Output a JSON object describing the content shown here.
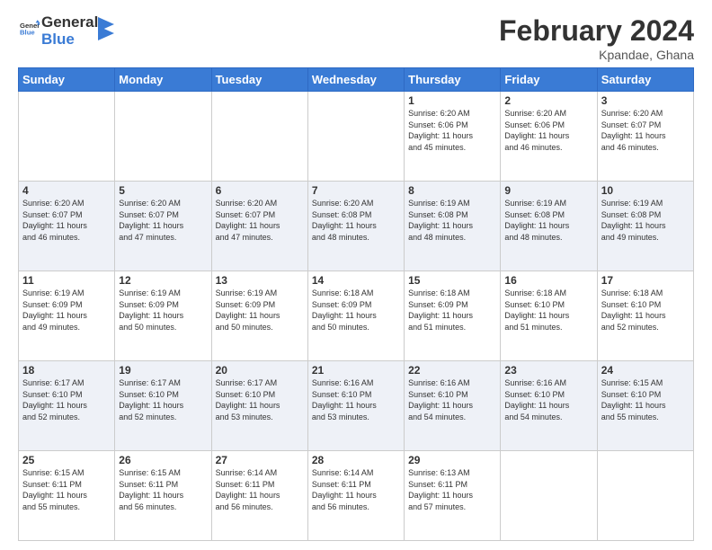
{
  "logo": {
    "line1": "General",
    "line2": "Blue"
  },
  "title": "February 2024",
  "location": "Kpandae, Ghana",
  "days_of_week": [
    "Sunday",
    "Monday",
    "Tuesday",
    "Wednesday",
    "Thursday",
    "Friday",
    "Saturday"
  ],
  "weeks": [
    [
      {
        "day": "",
        "info": ""
      },
      {
        "day": "",
        "info": ""
      },
      {
        "day": "",
        "info": ""
      },
      {
        "day": "",
        "info": ""
      },
      {
        "day": "1",
        "info": "Sunrise: 6:20 AM\nSunset: 6:06 PM\nDaylight: 11 hours\nand 45 minutes."
      },
      {
        "day": "2",
        "info": "Sunrise: 6:20 AM\nSunset: 6:06 PM\nDaylight: 11 hours\nand 46 minutes."
      },
      {
        "day": "3",
        "info": "Sunrise: 6:20 AM\nSunset: 6:07 PM\nDaylight: 11 hours\nand 46 minutes."
      }
    ],
    [
      {
        "day": "4",
        "info": "Sunrise: 6:20 AM\nSunset: 6:07 PM\nDaylight: 11 hours\nand 46 minutes."
      },
      {
        "day": "5",
        "info": "Sunrise: 6:20 AM\nSunset: 6:07 PM\nDaylight: 11 hours\nand 47 minutes."
      },
      {
        "day": "6",
        "info": "Sunrise: 6:20 AM\nSunset: 6:07 PM\nDaylight: 11 hours\nand 47 minutes."
      },
      {
        "day": "7",
        "info": "Sunrise: 6:20 AM\nSunset: 6:08 PM\nDaylight: 11 hours\nand 48 minutes."
      },
      {
        "day": "8",
        "info": "Sunrise: 6:19 AM\nSunset: 6:08 PM\nDaylight: 11 hours\nand 48 minutes."
      },
      {
        "day": "9",
        "info": "Sunrise: 6:19 AM\nSunset: 6:08 PM\nDaylight: 11 hours\nand 48 minutes."
      },
      {
        "day": "10",
        "info": "Sunrise: 6:19 AM\nSunset: 6:08 PM\nDaylight: 11 hours\nand 49 minutes."
      }
    ],
    [
      {
        "day": "11",
        "info": "Sunrise: 6:19 AM\nSunset: 6:09 PM\nDaylight: 11 hours\nand 49 minutes."
      },
      {
        "day": "12",
        "info": "Sunrise: 6:19 AM\nSunset: 6:09 PM\nDaylight: 11 hours\nand 50 minutes."
      },
      {
        "day": "13",
        "info": "Sunrise: 6:19 AM\nSunset: 6:09 PM\nDaylight: 11 hours\nand 50 minutes."
      },
      {
        "day": "14",
        "info": "Sunrise: 6:18 AM\nSunset: 6:09 PM\nDaylight: 11 hours\nand 50 minutes."
      },
      {
        "day": "15",
        "info": "Sunrise: 6:18 AM\nSunset: 6:09 PM\nDaylight: 11 hours\nand 51 minutes."
      },
      {
        "day": "16",
        "info": "Sunrise: 6:18 AM\nSunset: 6:10 PM\nDaylight: 11 hours\nand 51 minutes."
      },
      {
        "day": "17",
        "info": "Sunrise: 6:18 AM\nSunset: 6:10 PM\nDaylight: 11 hours\nand 52 minutes."
      }
    ],
    [
      {
        "day": "18",
        "info": "Sunrise: 6:17 AM\nSunset: 6:10 PM\nDaylight: 11 hours\nand 52 minutes."
      },
      {
        "day": "19",
        "info": "Sunrise: 6:17 AM\nSunset: 6:10 PM\nDaylight: 11 hours\nand 52 minutes."
      },
      {
        "day": "20",
        "info": "Sunrise: 6:17 AM\nSunset: 6:10 PM\nDaylight: 11 hours\nand 53 minutes."
      },
      {
        "day": "21",
        "info": "Sunrise: 6:16 AM\nSunset: 6:10 PM\nDaylight: 11 hours\nand 53 minutes."
      },
      {
        "day": "22",
        "info": "Sunrise: 6:16 AM\nSunset: 6:10 PM\nDaylight: 11 hours\nand 54 minutes."
      },
      {
        "day": "23",
        "info": "Sunrise: 6:16 AM\nSunset: 6:10 PM\nDaylight: 11 hours\nand 54 minutes."
      },
      {
        "day": "24",
        "info": "Sunrise: 6:15 AM\nSunset: 6:10 PM\nDaylight: 11 hours\nand 55 minutes."
      }
    ],
    [
      {
        "day": "25",
        "info": "Sunrise: 6:15 AM\nSunset: 6:11 PM\nDaylight: 11 hours\nand 55 minutes."
      },
      {
        "day": "26",
        "info": "Sunrise: 6:15 AM\nSunset: 6:11 PM\nDaylight: 11 hours\nand 56 minutes."
      },
      {
        "day": "27",
        "info": "Sunrise: 6:14 AM\nSunset: 6:11 PM\nDaylight: 11 hours\nand 56 minutes."
      },
      {
        "day": "28",
        "info": "Sunrise: 6:14 AM\nSunset: 6:11 PM\nDaylight: 11 hours\nand 56 minutes."
      },
      {
        "day": "29",
        "info": "Sunrise: 6:13 AM\nSunset: 6:11 PM\nDaylight: 11 hours\nand 57 minutes."
      },
      {
        "day": "",
        "info": ""
      },
      {
        "day": "",
        "info": ""
      }
    ]
  ]
}
